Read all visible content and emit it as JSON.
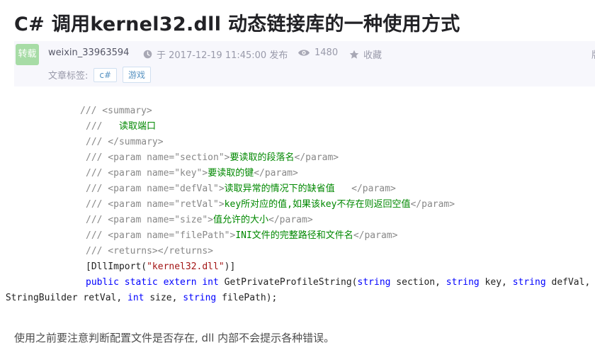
{
  "article": {
    "title": "C# 调用kernel32.dll 动态链接库的一种使用方式",
    "badge": "转载",
    "author": "weixin_33963594",
    "date": "于 2017-12-19 11:45:00 发布",
    "views": "1480",
    "favorite_label": "收藏",
    "edge_text": "版",
    "tags_label": "文章标签:",
    "tags": [
      "c#",
      "游戏"
    ]
  },
  "code_lines": {
    "l1": "/// <summary>",
    "l2_a": "///   ",
    "l2_b": "读取端口",
    "l3": "/// </summary>",
    "l4_a": "/// <param name=\"section\">",
    "l4_b": "要读取的段落名",
    "l4_c": "</param>",
    "l5_a": "/// <param name=\"key\">",
    "l5_b": "要读取的键",
    "l5_c": "</param>",
    "l6_a": "/// <param name=\"defVal\">",
    "l6_b": "读取异常的情况下的缺省值   ",
    "l6_c": "</param>",
    "l7_a": "/// <param name=\"retVal\">",
    "l7_b": "key所对应的值,如果该key不存在则返回空值",
    "l7_c": "</param>",
    "l8_a": "/// <param name=\"size\">",
    "l8_b": "值允许的大小",
    "l8_c": "</param>",
    "l9_a": "/// <param name=\"filePath\">",
    "l9_b": "INI文件的完整路径和文件名",
    "l9_c": "</param>",
    "l10": "/// <returns></returns>",
    "l11_a": "[DllImport(",
    "l11_b": "\"kernel32.dll\"",
    "l11_c": ")]",
    "l12_k1": "public static extern int",
    "l12_t1": " GetPrivateProfileString(",
    "l12_k2": "string",
    "l12_t2": " section, ",
    "l12_k3": "string",
    "l12_t3": " key, ",
    "l12_k4": "string",
    "l12_t4": " defVal,",
    "l13_t1": " StringBuilder retVal, ",
    "l13_k1": "int",
    "l13_t2": " size, ",
    "l13_k2": "string",
    "l13_t3": " filePath);"
  },
  "note": "使用之前要注意判断配置文件是否存在, dll 内部不会提示各种错误。"
}
